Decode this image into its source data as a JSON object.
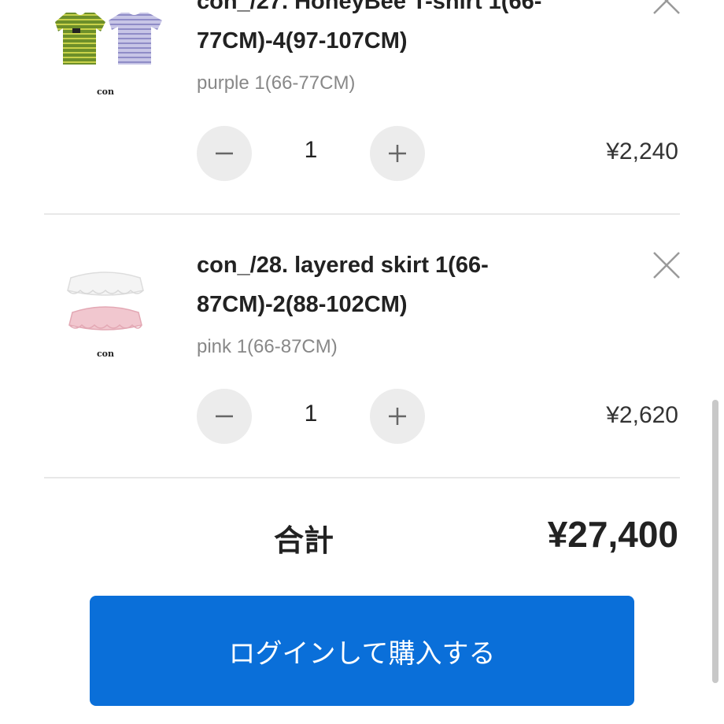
{
  "cart": {
    "items": [
      {
        "title_line1": "con_/27. HoneyBee T-shirt 1(66-",
        "title_line2": "77CM)-4(97-107CM)",
        "variant": "purple 1(66-77CM)",
        "quantity": "1",
        "price": "¥2,240",
        "brand": "con",
        "thumb_icon": "striped-tshirts-image"
      },
      {
        "title_line1": "con_/28. layered skirt 1(66-",
        "title_line2": "87CM)-2(88-102CM)",
        "variant": "pink 1(66-87CM)",
        "quantity": "1",
        "price": "¥2,620",
        "brand": "con",
        "thumb_icon": "layered-skirts-image"
      }
    ],
    "total_label": "合計",
    "total_value": "¥27,400",
    "checkout_button": "ログインして購入する"
  },
  "colors": {
    "accent": "#0a6fd9",
    "qty_button_bg": "#ececec",
    "divider": "#e8e8e8",
    "tshirt_green": "#6d8f2a",
    "tshirt_lavender": "#b9b7dc",
    "skirt_white": "#f2f2f2",
    "skirt_pink": "#f1c7cf"
  }
}
